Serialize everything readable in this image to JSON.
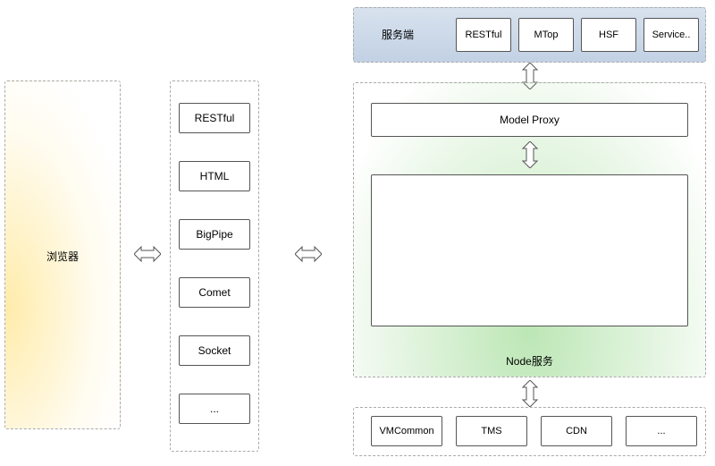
{
  "browser": {
    "label": "浏览器"
  },
  "protocols": {
    "items": [
      "RESTful",
      "HTML",
      "BigPipe",
      "Comet",
      "Socket",
      "..."
    ]
  },
  "server": {
    "label": "服务端",
    "items": [
      "RESTful",
      "MTop",
      "HSF",
      "Service.."
    ]
  },
  "node": {
    "label": "Node服务",
    "model_proxy": "Model Proxy"
  },
  "bottom": {
    "items": [
      "VMCommon",
      "TMS",
      "CDN",
      "..."
    ]
  },
  "watermark": ""
}
